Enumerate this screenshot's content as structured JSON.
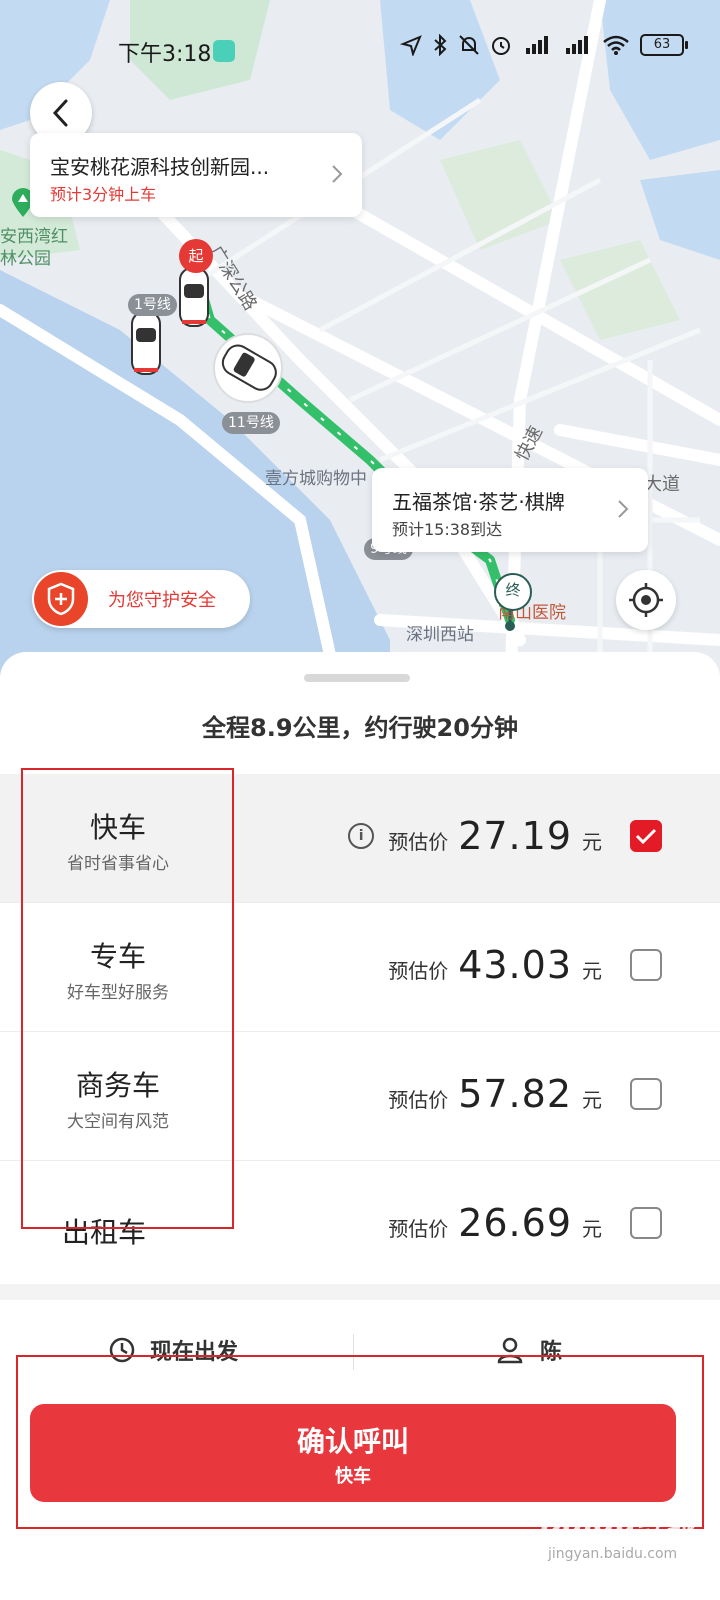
{
  "status_bar": {
    "time": "下午3:18",
    "battery": "63",
    "icons": [
      "location-arrow-icon",
      "bluetooth-icon",
      "mute-icon",
      "alarm-icon",
      "signal-hd-icon",
      "signal-hd-icon",
      "wifi-icon",
      "battery-icon"
    ]
  },
  "map": {
    "pickup": {
      "name": "宝安桃花源科技创新园...",
      "eta": "预计3分钟上车"
    },
    "destination": {
      "name": "五福茶馆·茶艺·棋牌",
      "eta": "预计15:38到达"
    },
    "start_marker": "起",
    "end_marker": "终",
    "labels": {
      "park": "安西湾红\n林公园",
      "road_guangshen": "广深公路",
      "mall": "壹方城购物中",
      "expressway": "快速",
      "avenue": "大道",
      "hospital": "南山医院",
      "station": "深圳西站"
    },
    "badges": {
      "line1": "1号线",
      "line11": "11号线",
      "line9": "9号线"
    },
    "safety_text": "为您守护安全",
    "colors": {
      "route": "#34c06a",
      "accent": "#e53935"
    }
  },
  "sheet": {
    "route_summary": "全程8.9公里，约行驶20分钟",
    "options": [
      {
        "title": "快车",
        "subtitle": "省时省事省心",
        "price_label": "预估价",
        "price": "27.19",
        "unit": "元",
        "checked": true,
        "has_info": true
      },
      {
        "title": "专车",
        "subtitle": "好车型好服务",
        "price_label": "预估价",
        "price": "43.03",
        "unit": "元",
        "checked": false,
        "has_info": false
      },
      {
        "title": "商务车",
        "subtitle": "大空间有风范",
        "price_label": "预估价",
        "price": "57.82",
        "unit": "元",
        "checked": false,
        "has_info": false
      },
      {
        "title": "出租车",
        "subtitle": "",
        "price_label": "预估价",
        "price": "26.69",
        "unit": "元",
        "checked": false,
        "has_info": false
      }
    ],
    "depart_label": "现在出发",
    "passenger_label": "陈",
    "confirm": {
      "main": "确认呼叫",
      "sub": "快车"
    },
    "colors": {
      "primary": "#e8383d",
      "highlight_box": "#d9262b"
    }
  },
  "watermark": {
    "brand": "Baidu经验",
    "url": "jingyan.baidu.com"
  }
}
